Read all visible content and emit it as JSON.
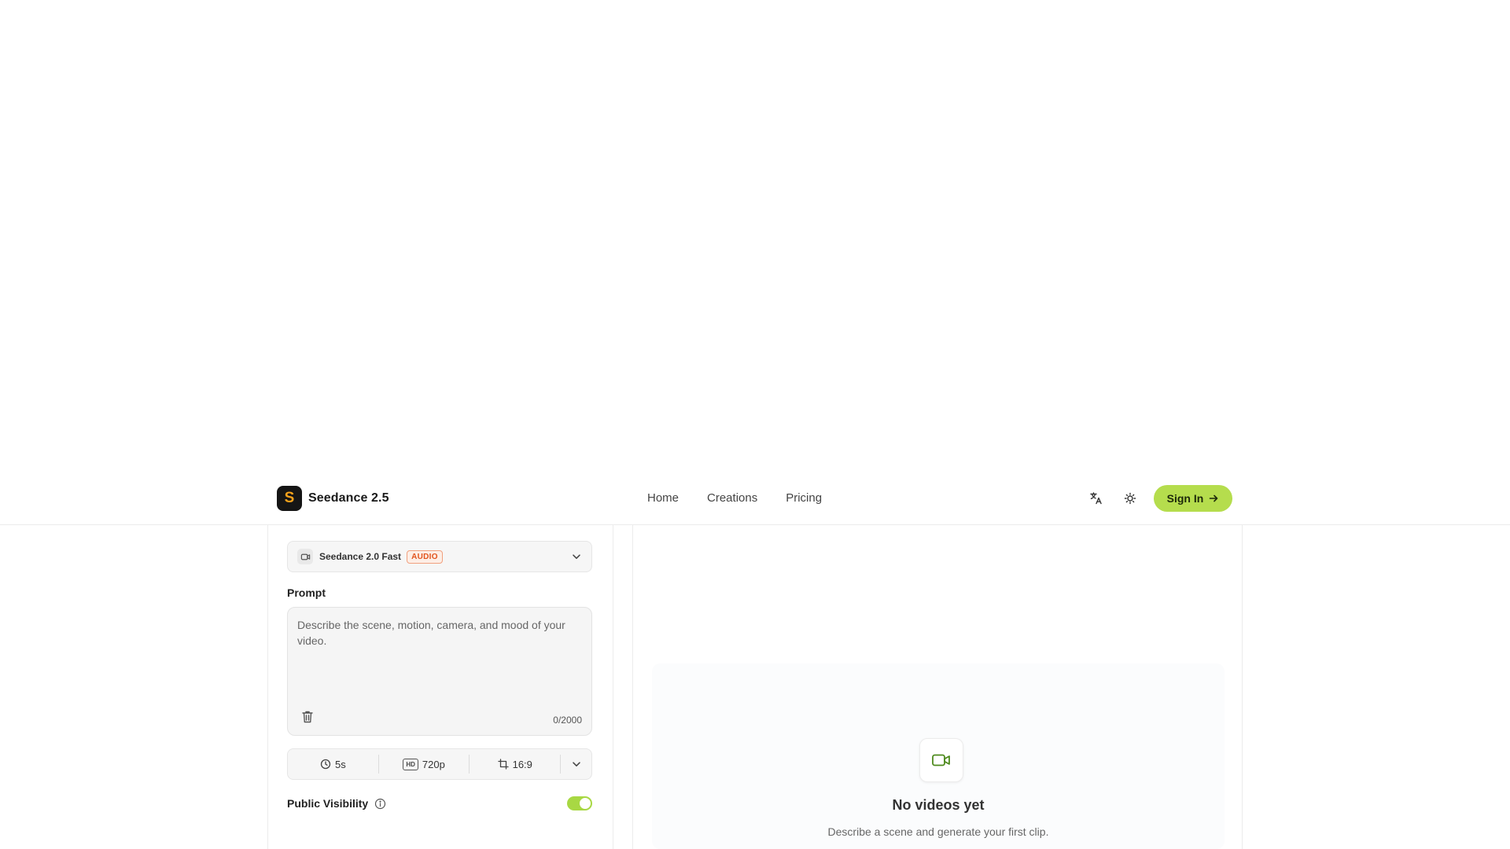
{
  "brand": {
    "logo_letter": "S",
    "name": "Seedance 2.5",
    "logo_color": "#f7a21b"
  },
  "nav": {
    "items": [
      {
        "label": "Home"
      },
      {
        "label": "Creations"
      },
      {
        "label": "Pricing"
      }
    ]
  },
  "header": {
    "translate_icon": "translate-icon",
    "theme_icon": "sun-icon",
    "sign_in_label": "Sign In",
    "accent_color": "#b5dd4d"
  },
  "generator": {
    "model": {
      "name": "Seedance 2.0 Fast",
      "badge": "AUDIO",
      "icon": "video-camera-icon"
    },
    "prompt": {
      "label": "Prompt",
      "value": "",
      "placeholder": "Describe the scene, motion, camera, and mood of your video.",
      "counter": "0/2000"
    },
    "settings": {
      "duration": "5s",
      "quality_tag": "HD",
      "resolution": "720p",
      "aspect_ratio": "16:9"
    },
    "visibility": {
      "label": "Public Visibility",
      "enabled": true
    }
  },
  "results": {
    "empty_title": "No videos yet",
    "empty_subtitle": "Describe a scene and generate your first clip.",
    "empty_icon": "video-camera-icon"
  }
}
